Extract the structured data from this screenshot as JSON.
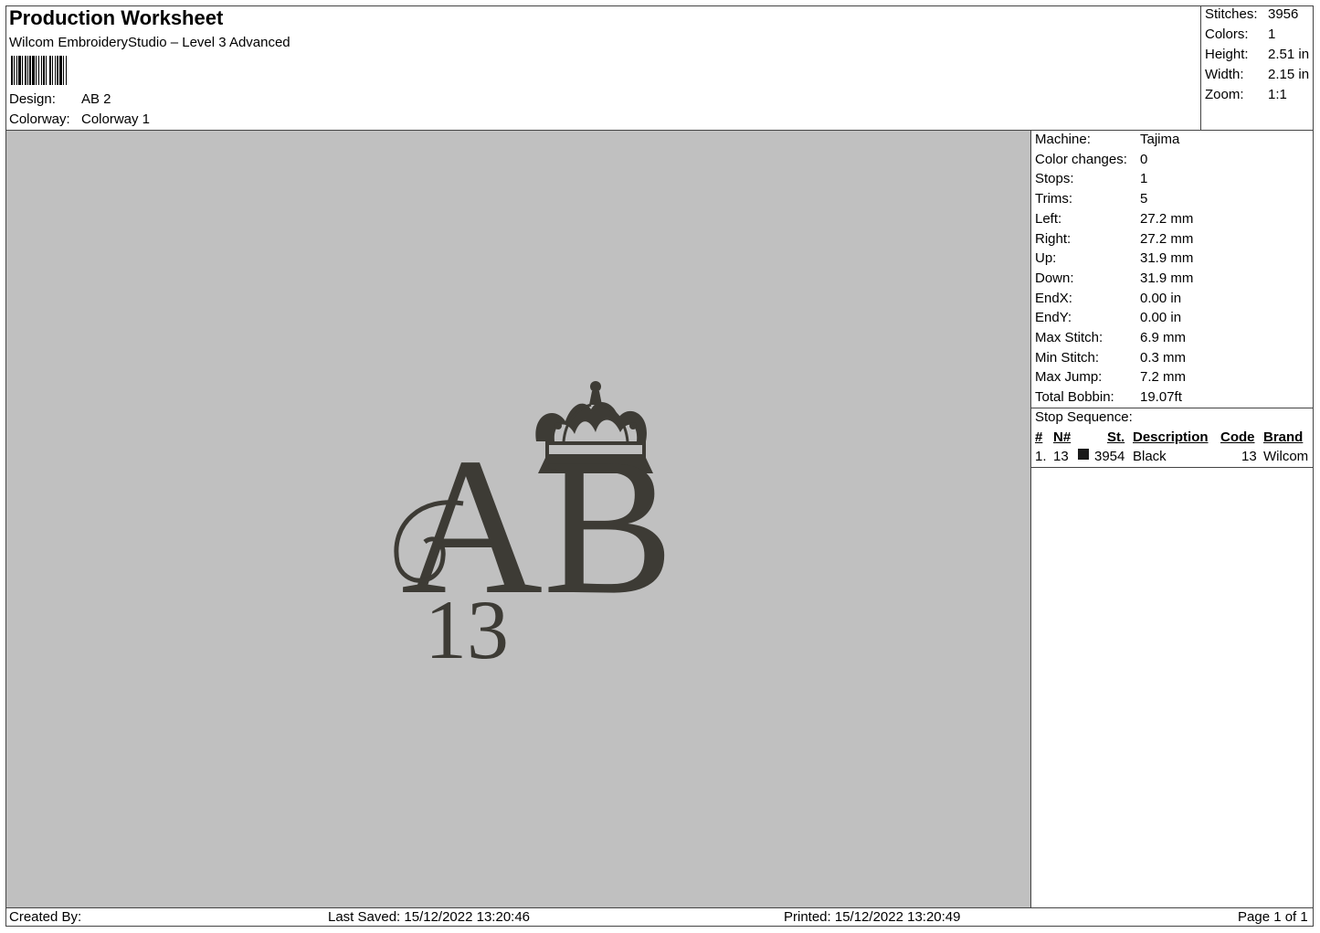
{
  "header": {
    "title": "Production Worksheet",
    "software": "Wilcom EmbroideryStudio – Level 3 Advanced",
    "design_label": "Design:",
    "design_value": "AB 2",
    "colorway_label": "Colorway:",
    "colorway_value": "Colorway 1"
  },
  "summary": [
    {
      "label": "Stitches:",
      "value": "3956"
    },
    {
      "label": "Colors:",
      "value": "1"
    },
    {
      "label": "Height:",
      "value": "2.51 in"
    },
    {
      "label": "Width:",
      "value": "2.15 in"
    },
    {
      "label": "Zoom:",
      "value": "1:1"
    }
  ],
  "details": [
    {
      "label": "Machine:",
      "value": "Tajima"
    },
    {
      "label": "Color changes:",
      "value": "0"
    },
    {
      "label": "Stops:",
      "value": "1"
    },
    {
      "label": "Trims:",
      "value": "5"
    },
    {
      "label": "Left:",
      "value": "27.2 mm"
    },
    {
      "label": "Right:",
      "value": "27.2 mm"
    },
    {
      "label": "Up:",
      "value": "31.9 mm"
    },
    {
      "label": "Down:",
      "value": "31.9 mm"
    },
    {
      "label": "EndX:",
      "value": "0.00 in"
    },
    {
      "label": "EndY:",
      "value": "0.00 in"
    },
    {
      "label": "Max Stitch:",
      "value": "6.9 mm"
    },
    {
      "label": "Min Stitch:",
      "value": "0.3 mm"
    },
    {
      "label": "Max Jump:",
      "value": "7.2 mm"
    },
    {
      "label": "Total Bobbin:",
      "value": "19.07ft"
    }
  ],
  "stop_sequence": {
    "title": "Stop Sequence:",
    "headers": [
      "#",
      "N#",
      "St.",
      "Description",
      "Code",
      "Brand"
    ],
    "rows": [
      {
        "index": "1.",
        "needle": "13",
        "swatch_color": "#1a1a1a",
        "stitches": "3954",
        "description": "Black",
        "code": "13",
        "brand": "Wilcom"
      }
    ]
  },
  "design_preview": {
    "letters": "AB",
    "number": "13",
    "thread_color": "#3d3b35",
    "background_color": "#c0c0c0"
  },
  "footer": {
    "created_by": "Created By:",
    "last_saved": "Last Saved: 15/12/2022 13:20:46",
    "printed": "Printed: 15/12/2022 13:20:49",
    "page": "Page 1 of 1"
  }
}
